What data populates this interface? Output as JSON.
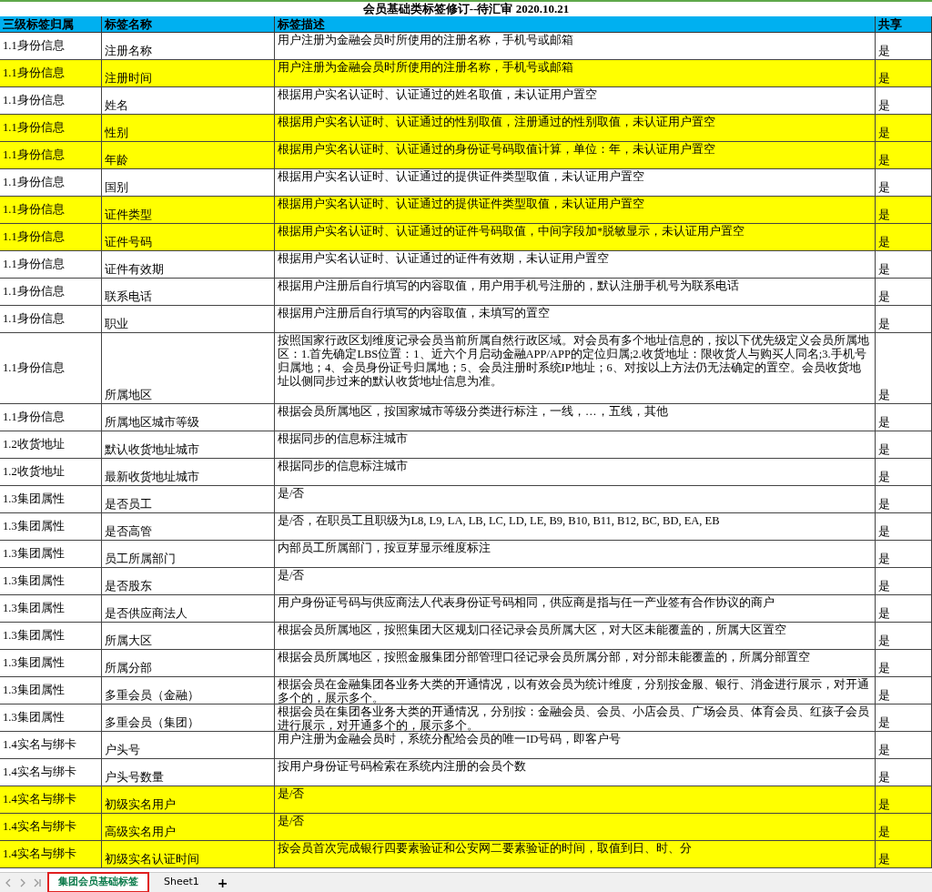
{
  "title": "会员基础类标签修订--待汇审 2020.10.21",
  "columns": [
    "三级标签归属",
    "标签名称",
    "标签描述",
    "共享"
  ],
  "rows": [
    {
      "group": "1.1身份信息",
      "name": "注册名称",
      "description": "用户注册为金融会员时所使用的注册名称，手机号或邮箱",
      "shared": "是",
      "highlighted": false
    },
    {
      "group": "1.1身份信息",
      "name": "注册时间",
      "description": "用户注册为金融会员时所使用的注册名称，手机号或邮箱",
      "shared": "是",
      "highlighted": true
    },
    {
      "group": "1.1身份信息",
      "name": "姓名",
      "description": "根据用户实名认证时、认证通过的姓名取值，未认证用户置空",
      "shared": "是",
      "highlighted": false
    },
    {
      "group": "1.1身份信息",
      "name": "性别",
      "description": "根据用户实名认证时、认证通过的性别取值，注册通过的性别取值，未认证用户置空",
      "shared": "是",
      "highlighted": true
    },
    {
      "group": "1.1身份信息",
      "name": "年龄",
      "description": "根据用户实名认证时、认证通过的身份证号码取值计算，单位：年，未认证用户置空",
      "shared": "是",
      "highlighted": true
    },
    {
      "group": "1.1身份信息",
      "name": "国别",
      "description": "根据用户实名认证时、认证通过的提供证件类型取值，未认证用户置空",
      "shared": "是",
      "highlighted": false
    },
    {
      "group": "1.1身份信息",
      "name": "证件类型",
      "description": "根据用户实名认证时、认证通过的提供证件类型取值，未认证用户置空",
      "shared": "是",
      "highlighted": true
    },
    {
      "group": "1.1身份信息",
      "name": "证件号码",
      "description": "根据用户实名认证时、认证通过的证件号码取值，中间字段加*脱敏显示，未认证用户置空",
      "shared": "是",
      "highlighted": true
    },
    {
      "group": "1.1身份信息",
      "name": "证件有效期",
      "description": "根据用户实名认证时、认证通过的证件有效期，未认证用户置空",
      "shared": "是",
      "highlighted": false
    },
    {
      "group": "1.1身份信息",
      "name": "联系电话",
      "description": "根据用户注册后自行填写的内容取值，用户用手机号注册的，默认注册手机号为联系电话",
      "shared": "是",
      "highlighted": false
    },
    {
      "group": "1.1身份信息",
      "name": "职业",
      "description": "根据用户注册后自行填写的内容取值，未填写的置空",
      "shared": "是",
      "highlighted": false
    },
    {
      "group": "1.1身份信息",
      "name": "所属地区",
      "description": "按照国家行政区划维度记录会员当前所属自然行政区域。对会员有多个地址信息的，按以下优先级定义会员所属地区：1.首先确定LBS位置：1、近六个月启动金融APP/APP的定位归属;2.收货地址：限收货人与购买人同名;3.手机号归属地；4、会员身份证号归属地；5、会员注册时系统IP地址；6、对按以上方法仍无法确定的置空。会员收货地址以侧同步过来的默认收货地址信息为准。",
      "shared": "是",
      "highlighted": false
    },
    {
      "group": "1.1身份信息",
      "name": "所属地区城市等级",
      "description": "根据会员所属地区，按国家城市等级分类进行标注，一线，…，五线，其他",
      "shared": "是",
      "highlighted": false
    },
    {
      "group": "1.2收货地址",
      "name": "默认收货地址城市",
      "description": "根据同步的信息标注城市",
      "shared": "是",
      "highlighted": false
    },
    {
      "group": "1.2收货地址",
      "name": "最新收货地址城市",
      "description": "根据同步的信息标注城市",
      "shared": "是",
      "highlighted": false
    },
    {
      "group": "1.3集团属性",
      "name": "是否员工",
      "description": "是/否",
      "shared": "是",
      "highlighted": false
    },
    {
      "group": "1.3集团属性",
      "name": "是否高管",
      "description": "是/否，在职员工且职级为L8, L9, LA, LB, LC, LD, LE, B9, B10, B11, B12, BC, BD, EA, EB",
      "shared": "是",
      "highlighted": false
    },
    {
      "group": "1.3集团属性",
      "name": "员工所属部门",
      "description": "内部员工所属部门，按豆芽显示维度标注",
      "shared": "是",
      "highlighted": false
    },
    {
      "group": "1.3集团属性",
      "name": "是否股东",
      "description": "是/否",
      "shared": "是",
      "highlighted": false
    },
    {
      "group": "1.3集团属性",
      "name": "是否供应商法人",
      "description": "用户身份证号码与供应商法人代表身份证号码相同，供应商是指与任一产业签有合作协议的商户",
      "shared": "是",
      "highlighted": false
    },
    {
      "group": "1.3集团属性",
      "name": "所属大区",
      "description": "根据会员所属地区，按照集团大区规划口径记录会员所属大区，对大区未能覆盖的，所属大区置空",
      "shared": "是",
      "highlighted": false
    },
    {
      "group": "1.3集团属性",
      "name": "所属分部",
      "description": "根据会员所属地区，按照金服集团分部管理口径记录会员所属分部，对分部未能覆盖的，所属分部置空",
      "shared": "是",
      "highlighted": false
    },
    {
      "group": "1.3集团属性",
      "name": "多重会员（金融）",
      "description": "根据会员在金融集团各业务大类的开通情况，以有效会员为统计维度，分别按金服、银行、消金进行展示，对开通多个的，展示多个。",
      "shared": "是",
      "highlighted": false
    },
    {
      "group": "1.3集团属性",
      "name": "多重会员（集团）",
      "description": "根据会员在集团各业务大类的开通情况，分别按：金融会员、会员、小店会员、广场会员、体育会员、红孩子会员进行展示，对开通多个的，展示多个。",
      "shared": "是",
      "highlighted": false
    },
    {
      "group": "1.4实名与绑卡",
      "name": "户头号",
      "description": "用户注册为金融会员时，系统分配给会员的唯一ID号码，即客户号",
      "shared": "是",
      "highlighted": false
    },
    {
      "group": "1.4实名与绑卡",
      "name": "户头号数量",
      "description": "按用户身份证号码检索在系统内注册的会员个数",
      "shared": "是",
      "highlighted": false
    },
    {
      "group": "1.4实名与绑卡",
      "name": "初级实名用户",
      "description": "是/否",
      "shared": "是",
      "highlighted": true
    },
    {
      "group": "1.4实名与绑卡",
      "name": "高级实名用户",
      "description": "是/否",
      "shared": "是",
      "highlighted": true
    },
    {
      "group": "1.4实名与绑卡",
      "name": "初级实名认证时间",
      "description": "按会员首次完成银行四要素验证和公安网二要素验证的时间，取值到日、时、分",
      "shared": "是",
      "highlighted": true
    }
  ],
  "sheet_tabs": [
    {
      "label": "集团会员基础标签",
      "selected": true
    },
    {
      "label": "Sheet1",
      "selected": false
    }
  ],
  "add_sheet": "+"
}
